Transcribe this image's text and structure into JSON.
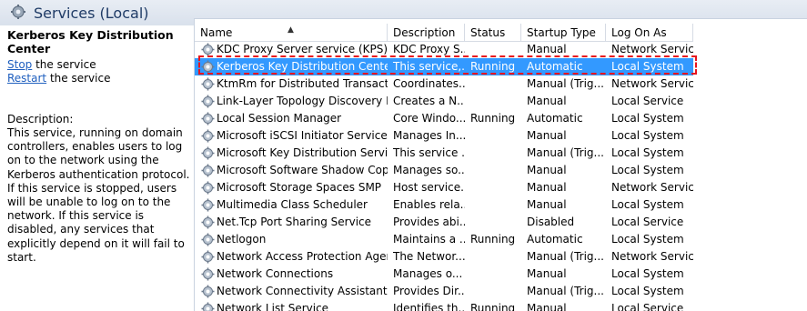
{
  "header": {
    "title": "Services (Local)",
    "icon": "services-gear-icon"
  },
  "details": {
    "service_name": "Kerberos Key Distribution Center",
    "stop_link": "Stop",
    "stop_suffix": " the service",
    "restart_link": "Restart",
    "restart_suffix": " the service",
    "description_label": "Description:",
    "description": "This service, running on domain controllers, enables users to log on to the network using the Kerberos authentication protocol. If this service is stopped, users will be unable to log on to the network. If this service is disabled, any services that explicitly depend on it will fail to start."
  },
  "columns": {
    "name": "Name",
    "description": "Description",
    "status": "Status",
    "startup_type": "Startup Type",
    "log_on_as": "Log On As"
  },
  "colors": {
    "selection": "#3399ff",
    "highlight_border": "#e8141e",
    "link": "#1f5fbf"
  },
  "rows": [
    {
      "name": "KDC Proxy Server service (KPS)",
      "description": "KDC Proxy S...",
      "status": "",
      "startup": "Manual",
      "logon": "Network Service"
    },
    {
      "name": "Kerberos Key Distribution Center",
      "description": "This service,...",
      "status": "Running",
      "startup": "Automatic",
      "logon": "Local System",
      "selected": true
    },
    {
      "name": "KtmRm for Distributed Transactio...",
      "description": "Coordinates...",
      "status": "",
      "startup": "Manual (Trig...",
      "logon": "Network Service"
    },
    {
      "name": "Link-Layer Topology Discovery M...",
      "description": "Creates a N...",
      "status": "",
      "startup": "Manual",
      "logon": "Local Service"
    },
    {
      "name": "Local Session Manager",
      "description": "Core Windo...",
      "status": "Running",
      "startup": "Automatic",
      "logon": "Local System"
    },
    {
      "name": "Microsoft iSCSI Initiator Service",
      "description": "Manages In...",
      "status": "",
      "startup": "Manual",
      "logon": "Local System"
    },
    {
      "name": "Microsoft Key Distribution Service",
      "description": "This service ...",
      "status": "",
      "startup": "Manual (Trig...",
      "logon": "Local System"
    },
    {
      "name": "Microsoft Software Shadow Copy...",
      "description": "Manages so...",
      "status": "",
      "startup": "Manual",
      "logon": "Local System"
    },
    {
      "name": "Microsoft Storage Spaces SMP",
      "description": "Host service...",
      "status": "",
      "startup": "Manual",
      "logon": "Network Service"
    },
    {
      "name": "Multimedia Class Scheduler",
      "description": "Enables rela...",
      "status": "",
      "startup": "Manual",
      "logon": "Local System"
    },
    {
      "name": "Net.Tcp Port Sharing Service",
      "description": "Provides abi...",
      "status": "",
      "startup": "Disabled",
      "logon": "Local Service"
    },
    {
      "name": "Netlogon",
      "description": "Maintains a ...",
      "status": "Running",
      "startup": "Automatic",
      "logon": "Local System"
    },
    {
      "name": "Network Access Protection Agent",
      "description": "The Networ...",
      "status": "",
      "startup": "Manual (Trig...",
      "logon": "Network Service"
    },
    {
      "name": "Network Connections",
      "description": "Manages o...",
      "status": "",
      "startup": "Manual",
      "logon": "Local System"
    },
    {
      "name": "Network Connectivity Assistant",
      "description": "Provides Dir...",
      "status": "",
      "startup": "Manual (Trig...",
      "logon": "Local System"
    },
    {
      "name": "Network List Service",
      "description": "Identifies th...",
      "status": "Running",
      "startup": "Manual",
      "logon": "Local Service"
    }
  ]
}
